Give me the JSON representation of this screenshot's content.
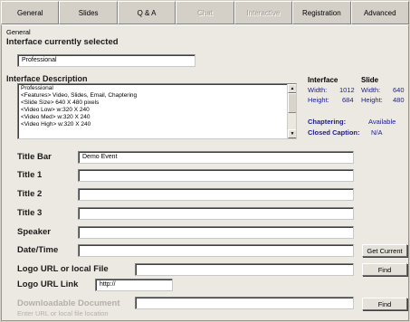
{
  "tabs": [
    {
      "label": "General"
    },
    {
      "label": "Slides"
    },
    {
      "label": "Q & A"
    },
    {
      "label": "Chat"
    },
    {
      "label": "Interactive"
    },
    {
      "label": "Registration"
    },
    {
      "label": "Advanced"
    }
  ],
  "general": {
    "group_label": "General",
    "interface_selected_heading": "Interface currently selected",
    "interface_selected_value": "Professional",
    "interface_desc_heading": "Interface Description",
    "description_lines": [
      "Professional",
      "<Features> Video, Slides, Email, Chaptering",
      "<Slide Size> 640 X 480 pixels",
      "<Video Low> w:320 X 240",
      "<Video Med> w:320 X 240",
      "<Video High> w:320 X 240"
    ]
  },
  "specs": {
    "interface_heading": "Interface",
    "slide_heading": "Slide",
    "width_label": "Width:",
    "height_label": "Height:",
    "interface_width": "1012",
    "interface_height": "684",
    "slide_width": "640",
    "slide_height": "480",
    "chaptering_label": "Chaptering:",
    "chaptering_value": "Available",
    "closed_caption_label": "Closed Caption:",
    "closed_caption_value": "N/A"
  },
  "form": {
    "title_bar_label": "Title Bar",
    "title_bar_value": "Demo Event",
    "title1_label": "Title 1",
    "title2_label": "Title 2",
    "title3_label": "Title 3",
    "speaker_label": "Speaker",
    "datetime_label": "Date/Time",
    "get_current_label": "Get Current",
    "logo_file_label": "Logo URL or local File",
    "logo_link_label": "Logo URL Link",
    "logo_link_value": "http://",
    "find_label": "Find",
    "downloadable_label": "Downloadable Document",
    "downloadable_hint": "Enter URL or local file location"
  },
  "colors": {
    "dialog_bg": "#d4d0c8",
    "panel_bg": "#ece9e2",
    "value_blue": "#1c1c8c",
    "disabled_text": "#b4b0a8"
  }
}
